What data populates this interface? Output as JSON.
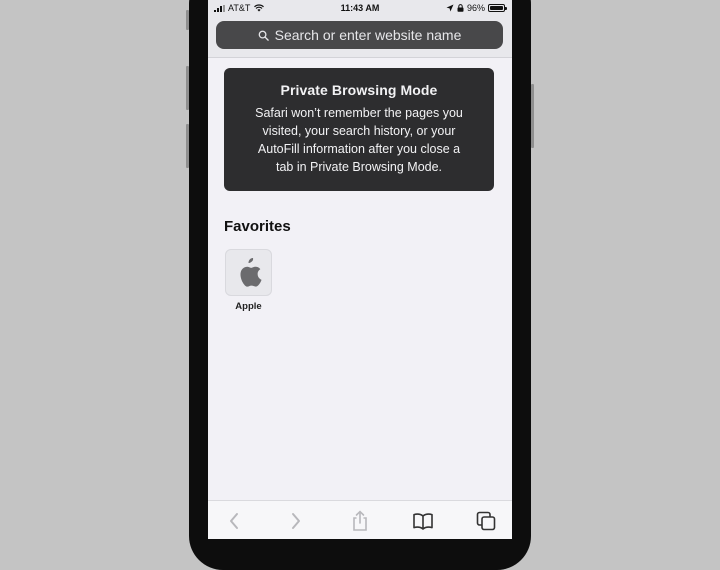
{
  "status_bar": {
    "carrier": "AT&T",
    "time": "11:43 AM",
    "battery": "96%",
    "battery_level": 0.96
  },
  "search": {
    "placeholder": "Search or enter website name"
  },
  "private_mode": {
    "title": "Private Browsing Mode",
    "lines": [
      "Safari won’t remember the pages you",
      "visited, your search history, or your",
      "AutoFill information after you close a",
      "tab in Private Browsing Mode."
    ]
  },
  "favorites": {
    "title": "Favorites",
    "items": [
      {
        "label": "Apple",
        "icon": "apple-logo-icon"
      }
    ]
  },
  "toolbar": {
    "icons": [
      "back-icon",
      "forward-icon",
      "share-icon",
      "bookmarks-icon",
      "tabs-icon"
    ]
  },
  "colors": {
    "search_bar": "#48484a",
    "card_bg": "#2d2d2f",
    "background": "#f2f1f6"
  }
}
